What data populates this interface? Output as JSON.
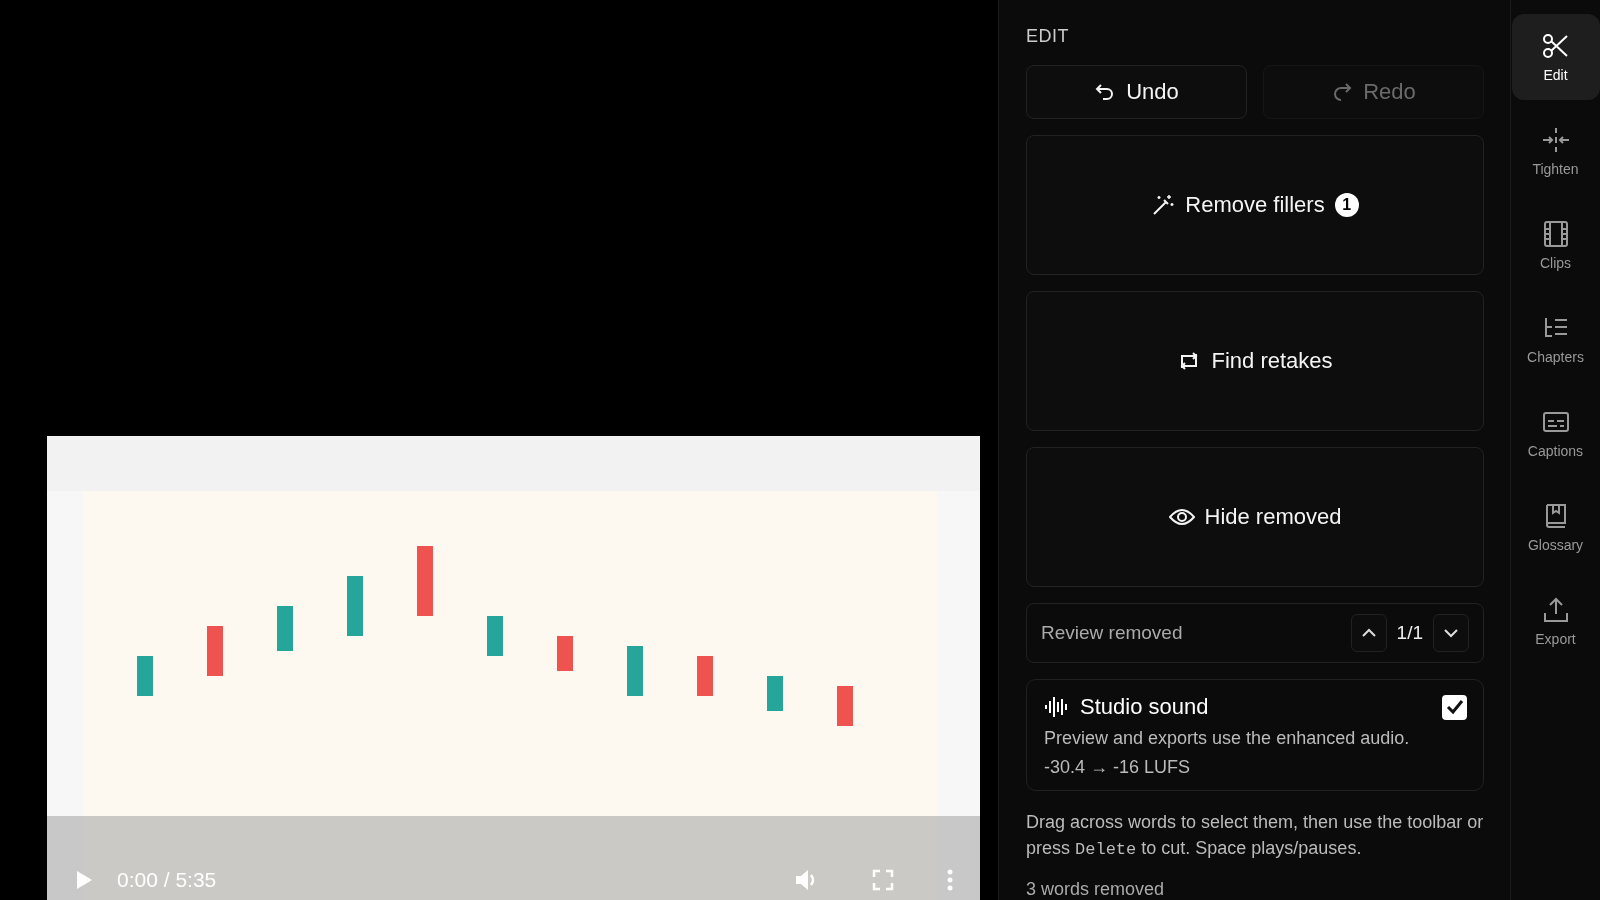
{
  "player": {
    "kind": "picture",
    "playing": false,
    "time": "0:00 / 5:35"
  },
  "panel": {
    "heading": "EDIT",
    "history": [
      {
        "label": "Undo",
        "kind": "undo",
        "disabled": false
      },
      {
        "label": "Redo",
        "kind": "redo",
        "disabled": true
      }
    ],
    "actions": [
      {
        "label": "Remove fillers",
        "kind": "wand",
        "badge": "1"
      },
      {
        "label": "Find retakes",
        "kind": "repeat"
      },
      {
        "label": "Hide removed",
        "kind": "eye"
      }
    ],
    "review": {
      "label": "Review removed",
      "count": "1/1"
    },
    "studio_sound": {
      "title": "Studio sound",
      "checked": true,
      "description": "Preview and exports use the enhanced audio.",
      "loudness": "-30.4 → -16 LUFS"
    },
    "help": {
      "before": "Drag across words to select them, then use the toolbar or press ",
      "key": "Delete",
      "after": " to cut. Space plays/pauses."
    },
    "removed_count": "3 words removed"
  },
  "rail": [
    {
      "label": "Edit",
      "kind": "scissors",
      "selected": true
    },
    {
      "label": "Tighten",
      "kind": "tighten",
      "selected": false
    },
    {
      "label": "Clips",
      "kind": "film",
      "selected": false
    },
    {
      "label": "Chapters",
      "kind": "chapters",
      "selected": false
    },
    {
      "label": "Captions",
      "kind": "captions",
      "selected": false
    },
    {
      "label": "Glossary",
      "kind": "book",
      "selected": false
    },
    {
      "label": "Export",
      "kind": "export",
      "selected": false
    }
  ]
}
